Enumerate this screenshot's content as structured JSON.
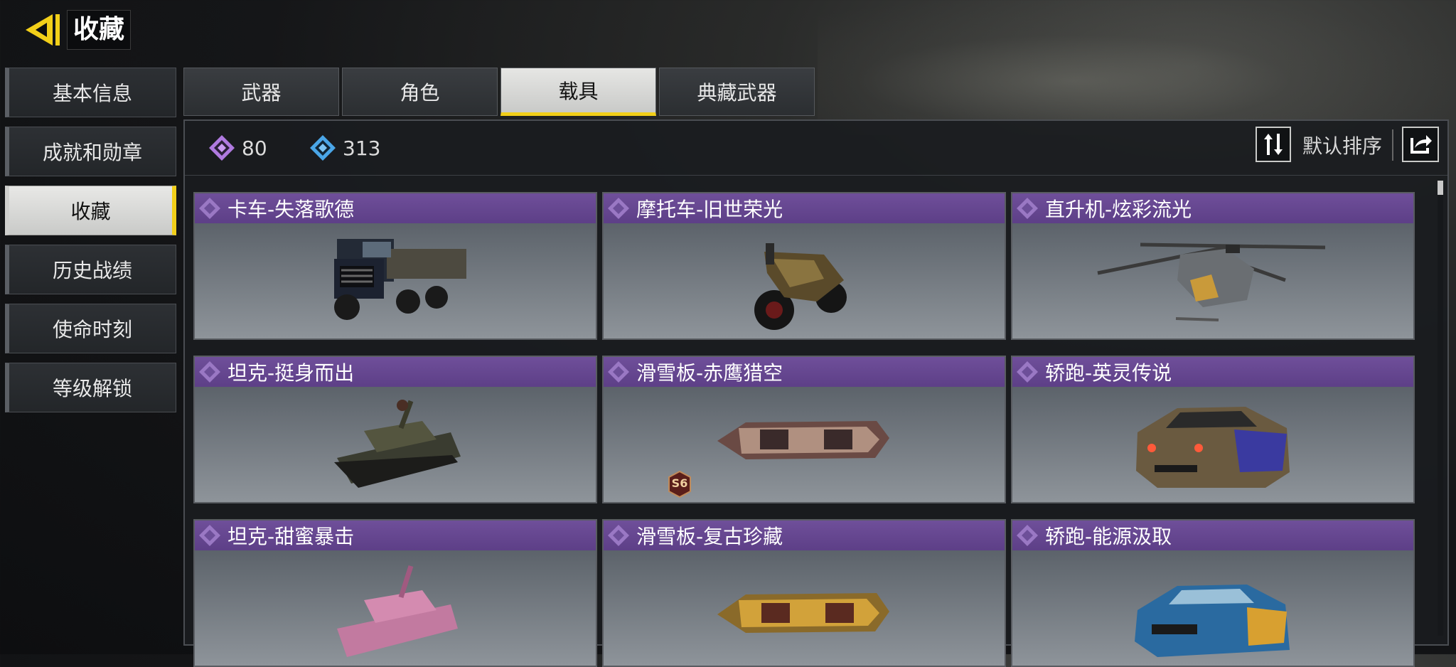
{
  "header": {
    "title": "收藏"
  },
  "sidebar": {
    "items": [
      {
        "label": "基本信息",
        "active": false
      },
      {
        "label": "成就和勋章",
        "active": false
      },
      {
        "label": "收藏",
        "active": true
      },
      {
        "label": "历史战绩",
        "active": false
      },
      {
        "label": "使命时刻",
        "active": false
      },
      {
        "label": "等级解锁",
        "active": false
      }
    ]
  },
  "tabs": [
    {
      "label": "武器",
      "active": false
    },
    {
      "label": "角色",
      "active": false
    },
    {
      "label": "载具",
      "active": true
    },
    {
      "label": "典藏武器",
      "active": false
    }
  ],
  "stats": {
    "purple_count": "80",
    "blue_count": "313"
  },
  "sort": {
    "label": "默认排序"
  },
  "cards": [
    {
      "name": "卡车-失落歌德",
      "vehicle": "truck"
    },
    {
      "name": "摩托车-旧世荣光",
      "vehicle": "motorcycle"
    },
    {
      "name": "直升机-炫彩流光",
      "vehicle": "helicopter"
    },
    {
      "name": "坦克-挺身而出",
      "vehicle": "tank"
    },
    {
      "name": "滑雪板-赤鹰猎空",
      "vehicle": "snowboard",
      "badge": "S6"
    },
    {
      "name": "轿跑-英灵传说",
      "vehicle": "sports-car"
    },
    {
      "name": "坦克-甜蜜暴击",
      "vehicle": "tank"
    },
    {
      "name": "滑雪板-复古珍藏",
      "vehicle": "snowboard"
    },
    {
      "name": "轿跑-能源汲取",
      "vehicle": "sports-car"
    }
  ],
  "colors": {
    "accent_yellow": "#f2cf19",
    "card_header_purple": "#6a4a96",
    "rarity_purple": "#b07ae0",
    "rarity_blue": "#4aa6e8"
  }
}
